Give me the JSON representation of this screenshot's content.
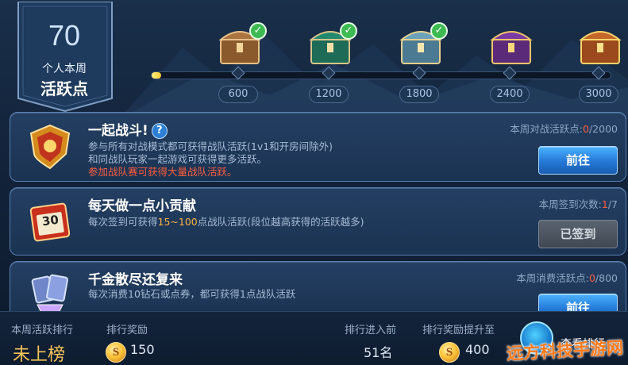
{
  "badge": {
    "points": "70",
    "label_line1": "个人本周",
    "label_line2": "活跃点"
  },
  "progress": {
    "fraction": 0.02,
    "milestones": [
      {
        "value": "600",
        "claimed": true,
        "chest": "bronze-chest-icon"
      },
      {
        "value": "1200",
        "claimed": true,
        "chest": "jade-chest-icon"
      },
      {
        "value": "1800",
        "claimed": true,
        "chest": "silver-chest-icon"
      },
      {
        "value": "2400",
        "claimed": false,
        "chest": "purple-chest-icon"
      },
      {
        "value": "3000",
        "claimed": false,
        "chest": "gold-chest-icon"
      }
    ]
  },
  "tasks": [
    {
      "title": "一起战斗!",
      "help": "?",
      "desc_line1": "参与所有对战模式都可获得战队活跃(1v1和开房间除外)",
      "desc_line2": "和同战队玩家一起游戏可获得更多活跃。",
      "desc_line3": "参加战队赛可获得大量战队活跃。",
      "stat_label": "本周对战活跃点:",
      "stat_current": "0",
      "stat_total": "/2000",
      "button": "前往",
      "icon": "battle-shield-icon"
    },
    {
      "title": "每天做一点小贡献",
      "desc_pre": "每次签到可获得",
      "desc_hl": "15~100",
      "desc_post": "点战队活跃(段位越高获得的活跃越多)",
      "stat_label": "本周签到次数:",
      "stat_current": "1",
      "stat_total": "/7",
      "button": "已签到",
      "icon": "calendar-icon",
      "calendar_day": "30"
    },
    {
      "title": "千金散尽还复来",
      "desc_line1": "每次消费10钻石或点券，都可获得1点战队活跃",
      "stat_label": "本周消费活跃点:",
      "stat_current": "0",
      "stat_total": "/800",
      "button": "前往",
      "icon": "diamond-cards-icon"
    }
  ],
  "bottom": {
    "rank_label": "本周活跃排行",
    "rank_value": "未上榜",
    "reward_label": "排行奖励",
    "reward_value": "150",
    "enter_label": "排行进入前",
    "enter_value": "51名",
    "up_label": "排行奖励提升至",
    "up_value": "400",
    "coin_glyph": "S",
    "view_rank": "查看排行"
  },
  "watermark": "远方科技手游网",
  "colors": {
    "accent_red": "#ff5c3c",
    "accent_orange": "#ffb13b",
    "button_blue": "#2478d6"
  }
}
